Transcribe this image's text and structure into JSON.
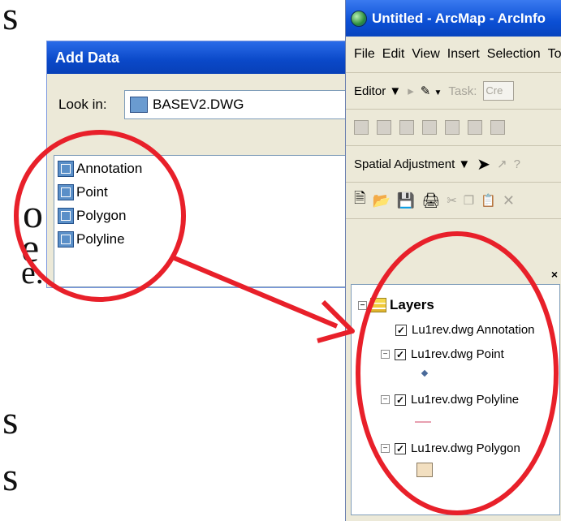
{
  "slide_fragments": [
    "s",
    "o",
    "e",
    "e.",
    "s",
    "s"
  ],
  "add_data": {
    "title": "Add Data",
    "look_in_label": "Look in:",
    "look_in_value": "BASEV2.DWG",
    "items": [
      "Annotation",
      "Point",
      "Polygon",
      "Polyline"
    ]
  },
  "arcmap": {
    "title": "Untitled - ArcMap - ArcInfo",
    "menu": [
      "File",
      "Edit",
      "View",
      "Insert",
      "Selection",
      "Too"
    ],
    "editor_label": "Editor ▼",
    "task_label": "Task:",
    "task_value": "Cre",
    "spatial_adjustment_label": "Spatial Adjustment ▼",
    "toc": {
      "close": "×",
      "layers_label": "Layers",
      "layers": [
        "Lu1rev.dwg Annotation",
        "Lu1rev.dwg Point",
        "Lu1rev.dwg Polyline",
        "Lu1rev.dwg Polygon"
      ]
    }
  },
  "annotation": {
    "stroke_color": "#e8202a"
  }
}
